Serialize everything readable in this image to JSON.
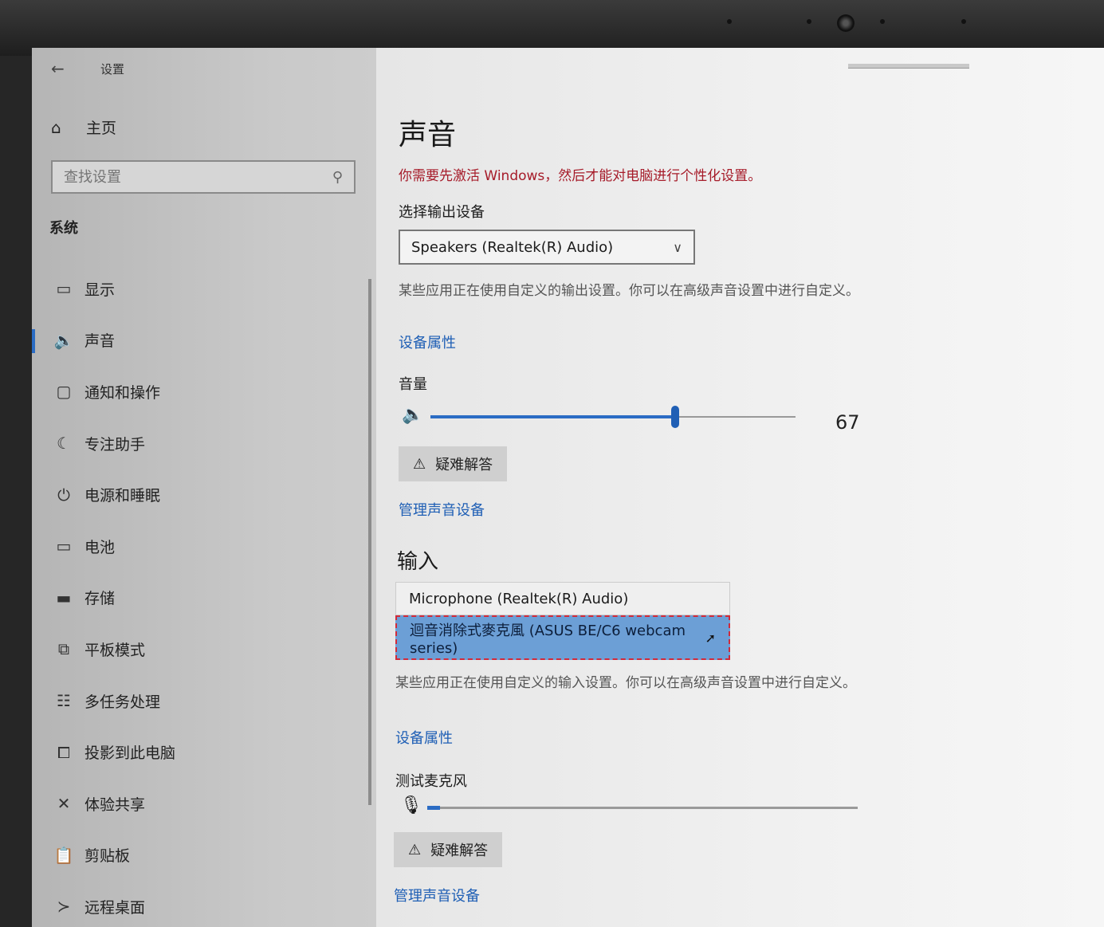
{
  "window": {
    "title": "设置"
  },
  "sidebar": {
    "home_label": "主页",
    "search_placeholder": "查找设置",
    "section": "系统",
    "items": [
      {
        "icon": "display-icon",
        "label": "显示"
      },
      {
        "icon": "speaker-icon",
        "label": "声音",
        "active": true
      },
      {
        "icon": "notification-icon",
        "label": "通知和操作"
      },
      {
        "icon": "moon-icon",
        "label": "专注助手"
      },
      {
        "icon": "power-icon",
        "label": "电源和睡眠"
      },
      {
        "icon": "battery-icon",
        "label": "电池"
      },
      {
        "icon": "storage-icon",
        "label": "存储"
      },
      {
        "icon": "tablet-icon",
        "label": "平板模式"
      },
      {
        "icon": "multitask-icon",
        "label": "多任务处理"
      },
      {
        "icon": "project-icon",
        "label": "投影到此电脑"
      },
      {
        "icon": "share-icon",
        "label": "体验共享"
      },
      {
        "icon": "clipboard-icon",
        "label": "剪贴板"
      },
      {
        "icon": "remote-desktop-icon",
        "label": "远程桌面"
      }
    ]
  },
  "main": {
    "title": "声音",
    "activation_warning": "你需要先激活 Windows，然后才能对电脑进行个性化设置。",
    "output": {
      "label": "选择输出设备",
      "selected": "Speakers (Realtek(R) Audio)",
      "note": "某些应用正在使用自定义的输出设置。你可以在高级声音设置中进行自定义。",
      "device_properties": "设备属性",
      "volume_label": "音量",
      "volume_value": "67",
      "volume": 67,
      "troubleshoot": "疑难解答",
      "manage_devices": "管理声音设备"
    },
    "input": {
      "heading": "输入",
      "options": [
        "Microphone (Realtek(R) Audio)",
        "迴音消除式麥克風 (ASUS BE/C6 webcam series)"
      ],
      "note": "某些应用正在使用自定义的输入设置。你可以在高级声音设置中进行自定义。",
      "device_properties": "设备属性",
      "test_label": "测试麦克风",
      "mic_level": 3,
      "troubleshoot": "疑难解答",
      "manage_devices": "管理声音设备"
    }
  },
  "colors": {
    "accent": "#1f5fb5",
    "warning": "#a61b29",
    "selection": "#6c9fd6"
  }
}
